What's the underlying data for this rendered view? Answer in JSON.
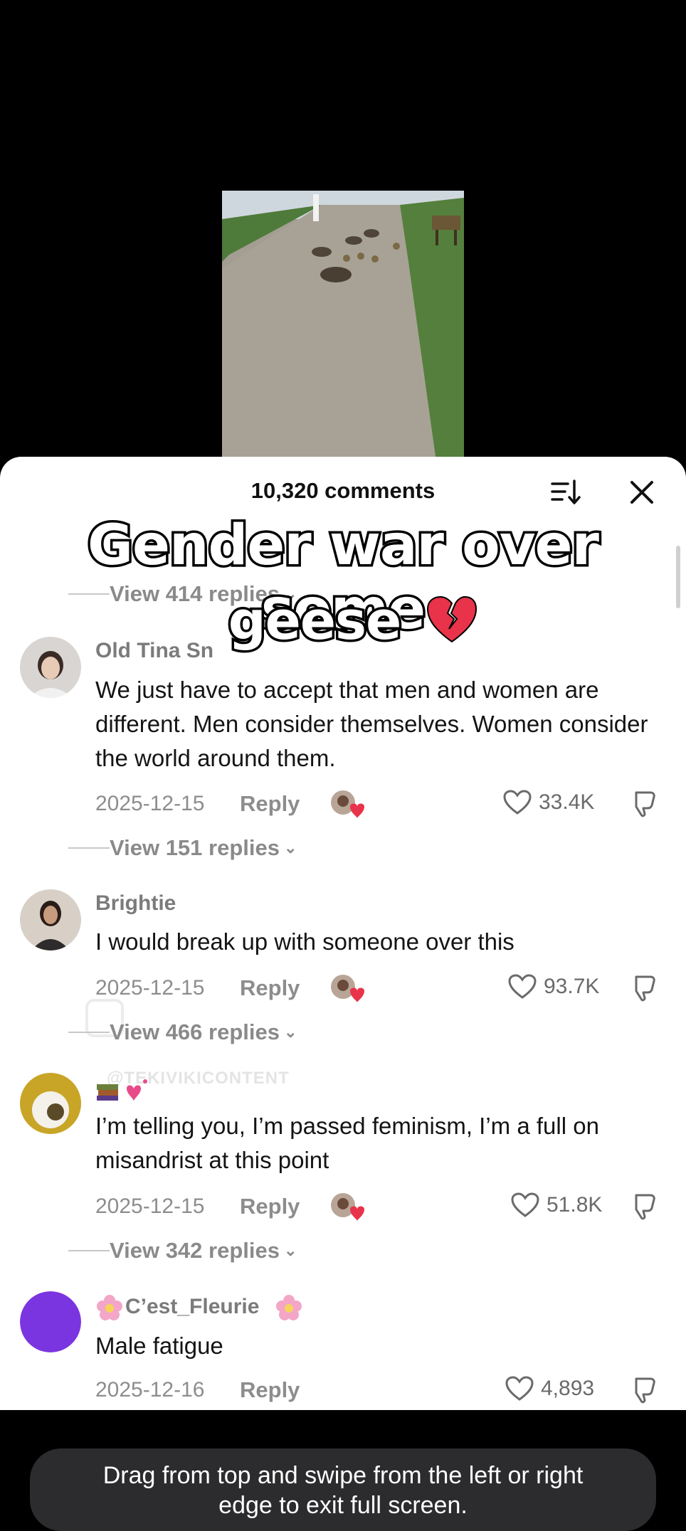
{
  "sheet": {
    "title": "10,320 comments",
    "sort_icon": "sort-icon",
    "close_icon": "close-icon"
  },
  "overlay": {
    "line1": "Gender war over some",
    "line2": "geese",
    "emoji": "broken-heart-emoji"
  },
  "comments": [
    {
      "view_replies": "View 414 replies"
    },
    {
      "user": "Old Tina Sn",
      "text": "We just have to accept that men and women are different. Men consider themselves. Women consider the world around them.",
      "date": "2025-12-15",
      "reply": "Reply",
      "likes": "33.4K",
      "view_replies": "View 151 replies"
    },
    {
      "user": "Brightie",
      "text": "I would break up with someone over this",
      "date": "2025-12-15",
      "reply": "Reply",
      "likes": "93.7K",
      "view_replies": "View 466 replies"
    },
    {
      "user": "",
      "text": "I’m telling you, I’m passed feminism, I’m a full on misandrist at this point",
      "date": "2025-12-15",
      "reply": "Reply",
      "likes": "51.8K",
      "view_replies": "View 342 replies"
    },
    {
      "user": "C’est_Fleurie",
      "text": "Male fatigue",
      "date": "2025-12-16",
      "reply": "Reply",
      "likes": "4,893"
    }
  ],
  "watermark": "@TEKIVIKICONTENT",
  "toast": {
    "line1": "Drag from top and swipe from the left or right",
    "line2": "edge to exit full screen."
  },
  "colors": {
    "sheet_bg": "#ffffff",
    "toast_bg": "#2c2c2e",
    "overlay_stroke": "#000000",
    "emoji_heart": "#e8334a"
  }
}
